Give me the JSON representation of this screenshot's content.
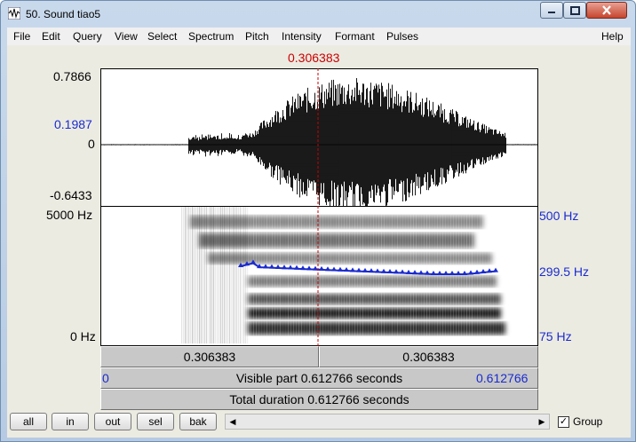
{
  "window": {
    "title": "50. Sound tiao5"
  },
  "menu": [
    "File",
    "Edit",
    "Query",
    "View",
    "Select",
    "Spectrum",
    "Pitch",
    "Intensity",
    "Formant",
    "Pulses",
    "Help"
  ],
  "cursor": {
    "time_label": "0.306383"
  },
  "waveform": {
    "max_label": "0.7866",
    "cursor_value_label": "0.1987",
    "zero_label": "0",
    "min_label": "-0.6433"
  },
  "spectrogram": {
    "freq_max_label": "5000 Hz",
    "freq_min_label": "0 Hz",
    "pitch_max_label": "500 Hz",
    "pitch_value_label": "299.5 Hz",
    "pitch_min_label": "75 Hz"
  },
  "selection_bar": {
    "left_label": "0.306383",
    "right_label": "0.306383"
  },
  "visible_bar": {
    "start_label": "0",
    "center_label": "Visible part 0.612766 seconds",
    "end_label": "0.612766"
  },
  "total_bar": {
    "label": "Total duration 0.612766 seconds"
  },
  "buttons": {
    "all": "all",
    "in": "in",
    "out": "out",
    "sel": "sel",
    "bak": "bak"
  },
  "group": {
    "label": "Group",
    "checked": true,
    "check_glyph": "✓"
  },
  "colors": {
    "cursor": "#cc0000",
    "pitch": "#1a2bcf",
    "axis_blue": "#1a2bcf"
  }
}
